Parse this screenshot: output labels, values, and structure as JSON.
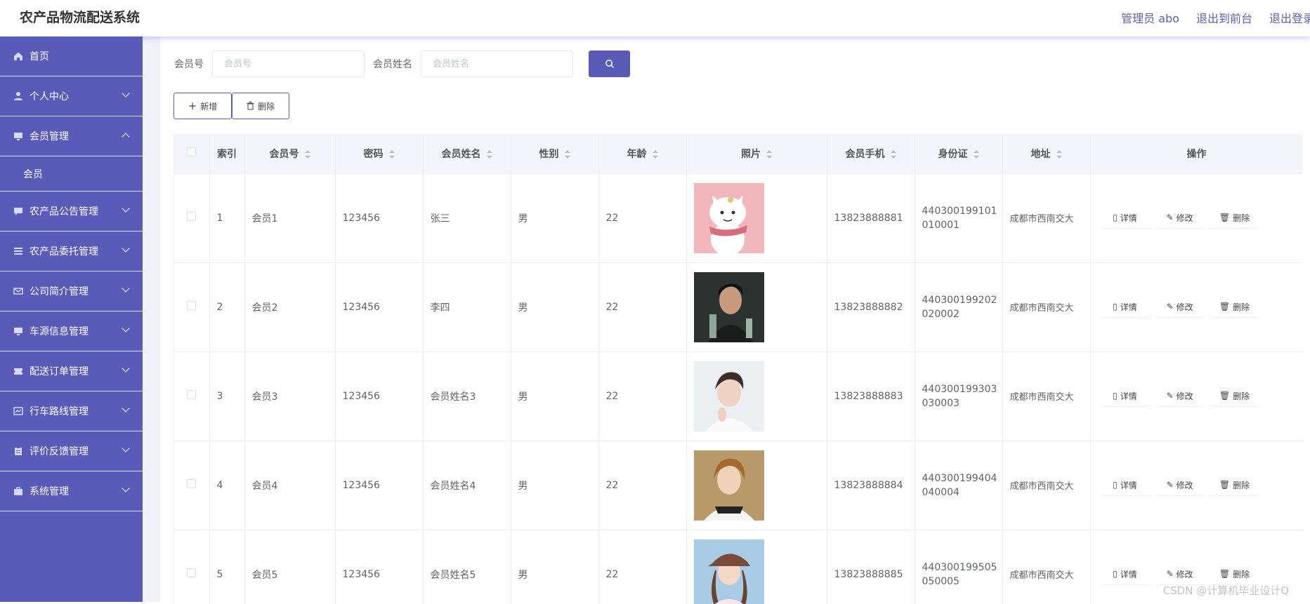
{
  "app": {
    "title": "农产品物流配送系统"
  },
  "top_links": {
    "admin": "管理员 abo",
    "front": "退出到前台",
    "logout": "退出登录"
  },
  "sidebar": {
    "items": [
      {
        "label": "首页",
        "icon": "home-icon"
      },
      {
        "label": "个人中心",
        "icon": "user-icon"
      },
      {
        "label": "会员管理",
        "icon": "monitor-icon",
        "expanded": true
      },
      {
        "label": "农产品公告管理",
        "icon": "chat-icon"
      },
      {
        "label": "农产品委托管理",
        "icon": "list-icon"
      },
      {
        "label": "公司简介管理",
        "icon": "mail-icon"
      },
      {
        "label": "车源信息管理",
        "icon": "monitor-icon"
      },
      {
        "label": "配送订单管理",
        "icon": "ticket-icon"
      },
      {
        "label": "行车路线管理",
        "icon": "form-icon"
      },
      {
        "label": "评价反馈管理",
        "icon": "clipboard-icon"
      },
      {
        "label": "系统管理",
        "icon": "briefcase-icon"
      }
    ],
    "sub_item": "会员"
  },
  "search": {
    "member_no_label": "会员号",
    "member_no_placeholder": "会员号",
    "member_name_label": "会员姓名",
    "member_name_placeholder": "会员姓名"
  },
  "actions": {
    "add": "新增",
    "delete": "删除"
  },
  "table": {
    "headers": {
      "index": "索引",
      "member_no": "会员号",
      "password": "密码",
      "name": "会员姓名",
      "gender": "性别",
      "age": "年龄",
      "photo": "照片",
      "phone": "会员手机",
      "id_card": "身份证",
      "address": "地址",
      "ops": "操作"
    },
    "op_labels": {
      "detail": "详情",
      "edit": "修改",
      "delete": "删除"
    },
    "rows": [
      {
        "index": "1",
        "member_no": "会员1",
        "password": "123456",
        "name": "张三",
        "gender": "男",
        "age": "22",
        "phone": "13823888881",
        "id_line1": "440300199101",
        "id_line2": "010001",
        "address": "成都市西南交大",
        "photo": "cartoon-cat"
      },
      {
        "index": "2",
        "member_no": "会员2",
        "password": "123456",
        "name": "李四",
        "gender": "男",
        "age": "22",
        "phone": "13823888882",
        "id_line1": "440300199202",
        "id_line2": "020002",
        "address": "成都市西南交大",
        "photo": "man-dark"
      },
      {
        "index": "3",
        "member_no": "会员3",
        "password": "123456",
        "name": "会员姓名3",
        "gender": "男",
        "age": "22",
        "phone": "13823888883",
        "id_line1": "440300199303",
        "id_line2": "030003",
        "address": "成都市西南交大",
        "photo": "man-white"
      },
      {
        "index": "4",
        "member_no": "会员4",
        "password": "123456",
        "name": "会员姓名4",
        "gender": "男",
        "age": "22",
        "phone": "13823888884",
        "id_line1": "440300199404",
        "id_line2": "040004",
        "address": "成都市西南交大",
        "photo": "boy-cap"
      },
      {
        "index": "5",
        "member_no": "会员5",
        "password": "123456",
        "name": "会员姓名5",
        "gender": "男",
        "age": "22",
        "phone": "13823888885",
        "id_line1": "440300199505",
        "id_line2": "050005",
        "address": "成都市西南交大",
        "photo": "girl-hat"
      }
    ]
  },
  "watermark": "CSDN @计算机毕业设计Q"
}
